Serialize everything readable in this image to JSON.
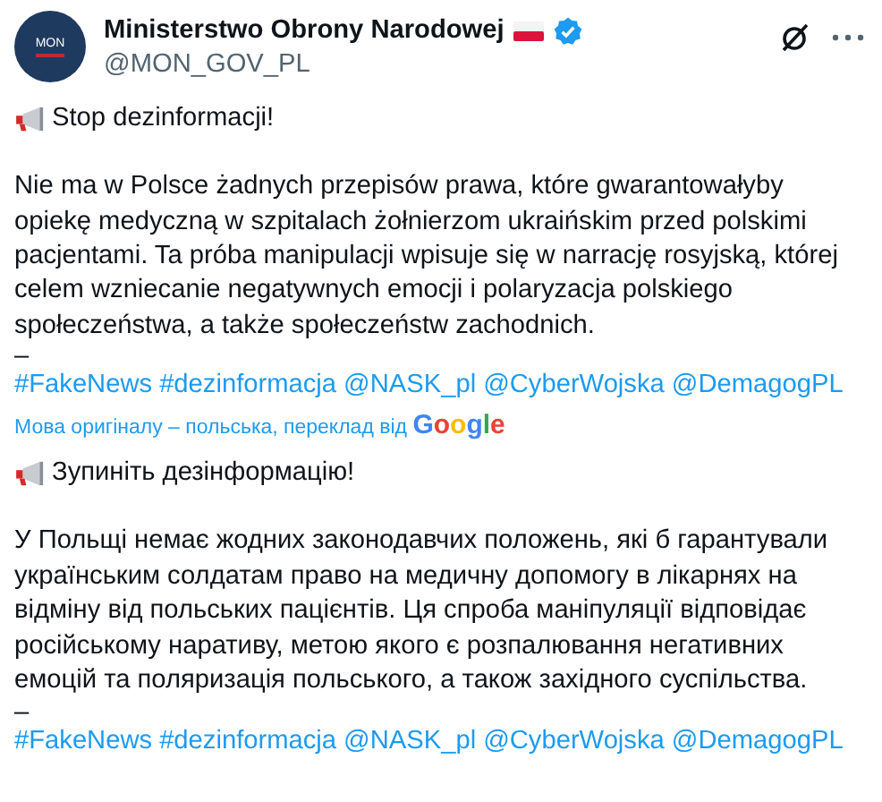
{
  "post": {
    "author": {
      "name": "Ministerstwo Obrony Narodowej",
      "handle": "@MON_GOV_PL",
      "avatar_text": "MON",
      "verified": true
    },
    "original": {
      "headline": "Stop dezinformacji!",
      "paragraph": "Nie ma w Polsce żadnych przepisów prawa, które gwarantowałyby opiekę medyczną w szpitalach żołnierzom ukraińskim przed polskimi pacjentami. Ta próba manipulacji wpisuje się w narrację rosyjską, której celem wzniecanie negatywnych emocji i polaryzacja polskiego społeczeństwa, a także społeczeństw zachodnich.",
      "separator": "–",
      "tags": [
        "#FakeNews",
        "#dezinformacja",
        "@NASK_pl",
        "@CyberWojska",
        "@DemagogPL"
      ]
    },
    "translation_note": {
      "text": "Мова оригіналу – польська, переклад від",
      "provider": "Google"
    },
    "translated": {
      "headline": "Зупиніть дезінформацію!",
      "paragraph": "У Польщі немає жодних законодавчих положень, які б гарантували українським солдатам право на медичну допомогу в лікарнях на відміну від польських пацієнтів. Ця спроба маніпуляції відповідає російському наративу, метою якого є розпалювання негативних емоцій та поляризація польського, а також західного суспільства.",
      "separator": "–",
      "tags": [
        "#FakeNews",
        "#dezinformacja",
        "@NASK_pl",
        "@CyberWojska",
        "@DemagogPL"
      ]
    }
  }
}
